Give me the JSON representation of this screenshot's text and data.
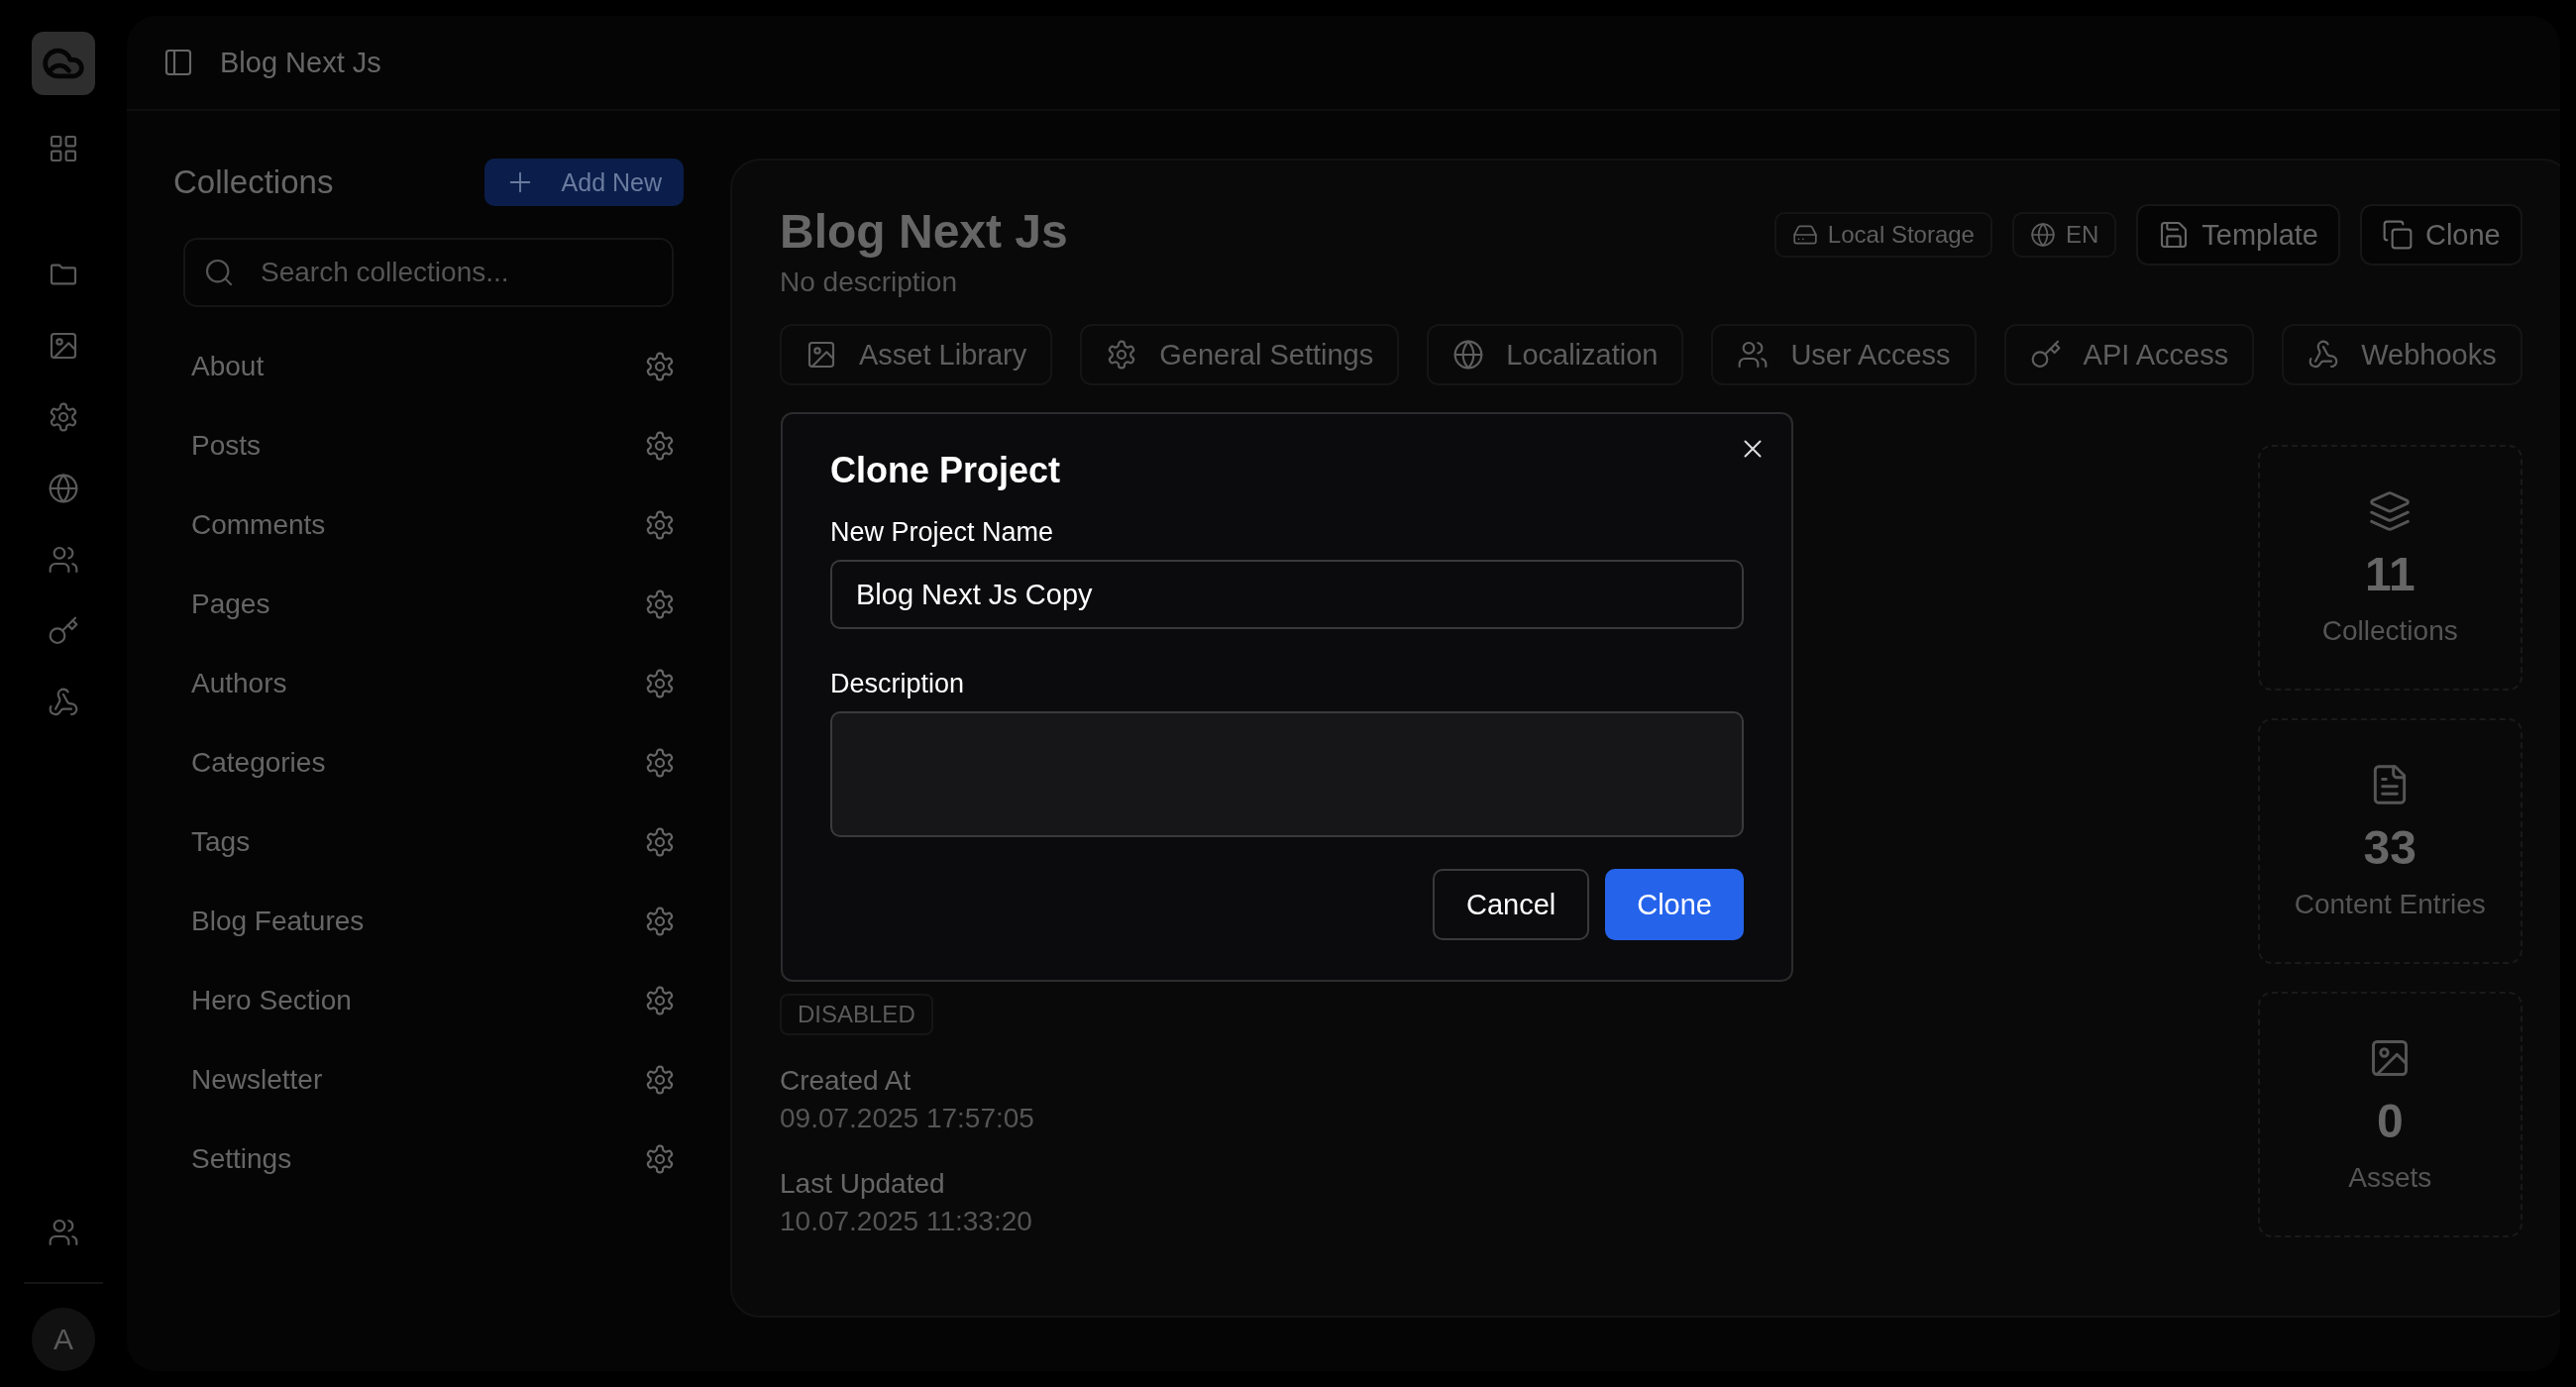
{
  "rail": {
    "avatar": "A"
  },
  "topbar": {
    "title": "Blog Next Js"
  },
  "collections": {
    "title": "Collections",
    "add_button": "Add New",
    "search": {
      "placeholder": "Search collections..."
    },
    "items": [
      {
        "label": "About"
      },
      {
        "label": "Posts"
      },
      {
        "label": "Comments"
      },
      {
        "label": "Pages"
      },
      {
        "label": "Authors"
      },
      {
        "label": "Categories"
      },
      {
        "label": "Tags"
      },
      {
        "label": "Blog Features"
      },
      {
        "label": "Hero Section"
      },
      {
        "label": "Newsletter"
      },
      {
        "label": "Settings"
      }
    ]
  },
  "project": {
    "title": "Blog Next Js",
    "description": "No description",
    "badges": [
      {
        "kind": "storage",
        "label": "Local Storage"
      },
      {
        "kind": "language",
        "label": "EN"
      }
    ],
    "actions": [
      {
        "kind": "template",
        "label": "Template"
      },
      {
        "kind": "clone",
        "label": "Clone"
      }
    ],
    "tabs": [
      {
        "kind": "assets",
        "label": "Asset Library"
      },
      {
        "kind": "settings",
        "label": "General Settings"
      },
      {
        "kind": "localization",
        "label": "Localization"
      },
      {
        "kind": "users",
        "label": "User Access"
      },
      {
        "kind": "api",
        "label": "API Access"
      },
      {
        "kind": "webhooks",
        "label": "Webhooks"
      }
    ],
    "status": "DISABLED",
    "meta": [
      {
        "label": "Created At",
        "value": "09.07.2025 17:57:05"
      },
      {
        "label": "Last Updated",
        "value": "10.07.2025 11:33:20"
      }
    ],
    "stats": [
      {
        "kind": "collections",
        "value": "11",
        "label": "Collections"
      },
      {
        "kind": "entries",
        "value": "33",
        "label": "Content Entries"
      },
      {
        "kind": "assets",
        "value": "0",
        "label": "Assets"
      }
    ]
  },
  "dialog": {
    "title": "Clone Project",
    "fields": [
      {
        "kind": "text",
        "label": "New Project Name",
        "value": "Blog Next Js Copy"
      },
      {
        "kind": "textarea",
        "label": "Description"
      }
    ],
    "buttons": [
      {
        "kind": "secondary",
        "label": "Cancel"
      },
      {
        "kind": "primary",
        "label": "Clone"
      }
    ]
  }
}
